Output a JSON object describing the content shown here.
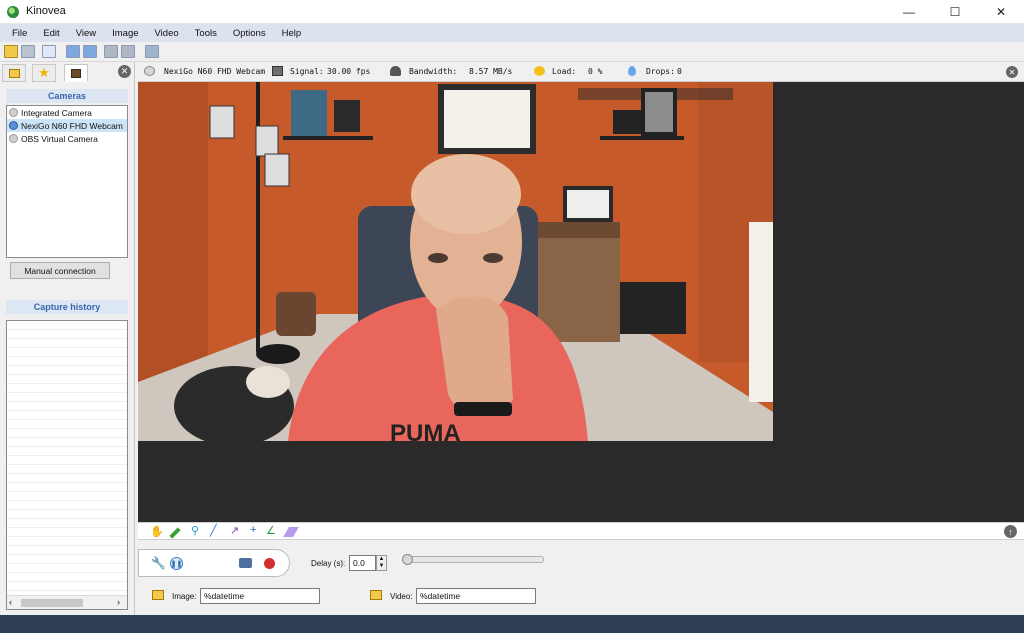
{
  "window": {
    "title": "Kinovea",
    "minimize_glyph": "—",
    "maximize_glyph": "☐",
    "close_glyph": "✕"
  },
  "menu": [
    "File",
    "Edit",
    "View",
    "Image",
    "Video",
    "Tools",
    "Options",
    "Help"
  ],
  "left_panel": {
    "cameras_header": "Cameras",
    "cameras": [
      {
        "label": "Integrated Camera",
        "selected": false
      },
      {
        "label": "NexiGo N60 FHD Webcam",
        "selected": true
      },
      {
        "label": "OBS Virtual Camera",
        "selected": false
      }
    ],
    "manual_connection_label": "Manual connection",
    "history_header": "Capture history"
  },
  "camera_strip": {
    "camera_name": "NexiGo N60 FHD Webcam",
    "signal_label": "Signal:",
    "signal_value": "30.00 fps",
    "bandwidth_label": "Bandwidth:",
    "bandwidth_value": "8.57 MB/s",
    "load_label": "Load:",
    "load_value": "0 %",
    "drops_label": "Drops:",
    "drops_value": "0"
  },
  "capture": {
    "delay_label": "Delay (s):",
    "delay_value": "0.0",
    "image_label": "Image:",
    "image_value": "%datetime",
    "video_label": "Video:",
    "video_value": "%datetime"
  },
  "colors": {
    "menubar": "#dce3ee",
    "panel_header_text": "#3a66b0",
    "record_red": "#d32f2f",
    "video_background": "#2a2a2a"
  }
}
